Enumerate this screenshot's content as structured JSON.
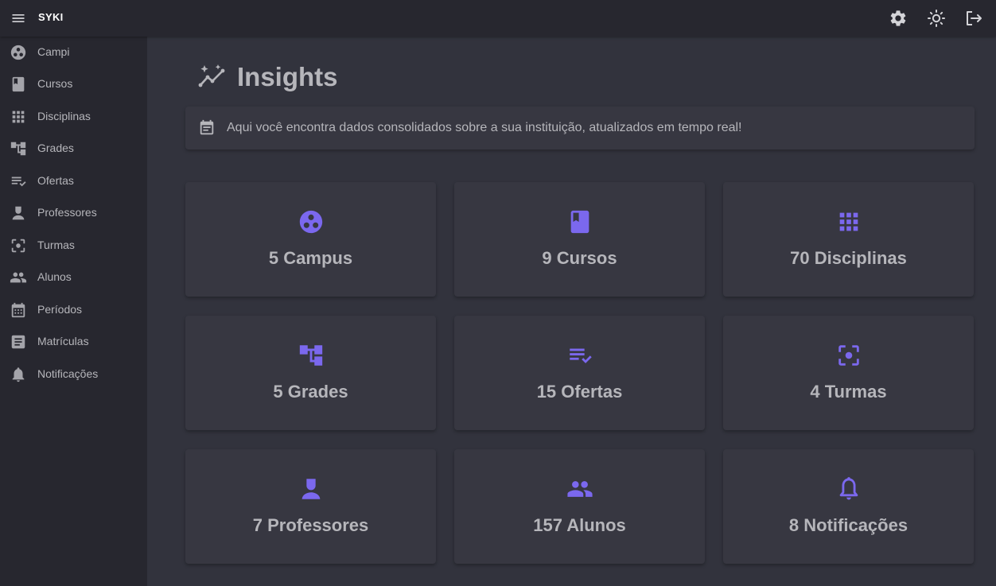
{
  "app": {
    "brand": "SYKI"
  },
  "colors": {
    "accent": "#7b68ee",
    "sidebar_bg": "#27272f",
    "content_bg": "#32333d",
    "card_bg": "#373741",
    "text": "#b6b6bb"
  },
  "header_actions": [
    {
      "icon": "gear-icon"
    },
    {
      "icon": "sun-icon"
    },
    {
      "icon": "logout-icon"
    }
  ],
  "sidebar": {
    "items": [
      {
        "label": "Campi",
        "icon": "campus-icon"
      },
      {
        "label": "Cursos",
        "icon": "book-icon"
      },
      {
        "label": "Disciplinas",
        "icon": "grid-icon"
      },
      {
        "label": "Grades",
        "icon": "account-tree-icon"
      },
      {
        "label": "Ofertas",
        "icon": "checklist-icon"
      },
      {
        "label": "Professores",
        "icon": "person-icon"
      },
      {
        "label": "Turmas",
        "icon": "center-focus-icon"
      },
      {
        "label": "Alunos",
        "icon": "people-icon"
      },
      {
        "label": "Períodos",
        "icon": "calendar-icon"
      },
      {
        "label": "Matrículas",
        "icon": "article-icon"
      },
      {
        "label": "Notificações",
        "icon": "bell-icon"
      }
    ]
  },
  "main": {
    "title": "Insights",
    "info": "Aqui você encontra dados consolidados sobre a sua instituição, atualizados em tempo real!",
    "cards": [
      {
        "text": "5 Campus",
        "icon": "campus-icon"
      },
      {
        "text": "9 Cursos",
        "icon": "book-icon"
      },
      {
        "text": "70 Disciplinas",
        "icon": "grid-icon"
      },
      {
        "text": "5 Grades",
        "icon": "account-tree-icon"
      },
      {
        "text": "15 Ofertas",
        "icon": "checklist-icon"
      },
      {
        "text": "4 Turmas",
        "icon": "center-focus-icon"
      },
      {
        "text": "7 Professores",
        "icon": "person-icon"
      },
      {
        "text": "157 Alunos",
        "icon": "people-icon"
      },
      {
        "text": "8 Notificações",
        "icon": "bell-icon"
      }
    ]
  }
}
